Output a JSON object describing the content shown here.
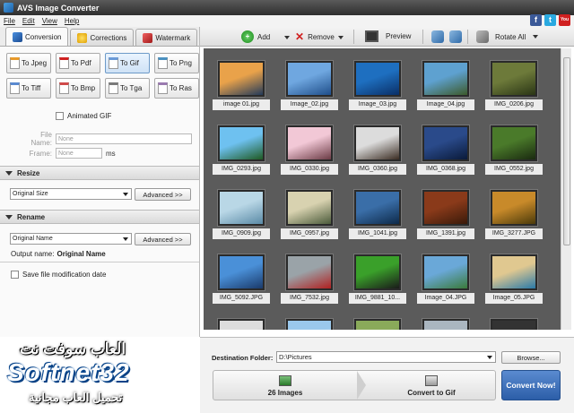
{
  "window": {
    "title": "AVS Image Converter"
  },
  "menu": [
    "File",
    "Edit",
    "View",
    "Help"
  ],
  "social": [
    {
      "icon": "facebook-icon",
      "glyph": "f",
      "color": "#3b5998"
    },
    {
      "icon": "twitter-icon",
      "glyph": "t",
      "color": "#2aa9e0"
    },
    {
      "icon": "youtube-icon",
      "glyph": "You",
      "color": "#d02020"
    }
  ],
  "tabs": [
    {
      "label": "Conversion",
      "icon": "conversion-icon",
      "active": true
    },
    {
      "label": "Corrections",
      "icon": "star-icon"
    },
    {
      "label": "Watermark",
      "icon": "watermark-icon"
    }
  ],
  "formats": [
    {
      "label": "To Jpeg"
    },
    {
      "label": "To Pdf"
    },
    {
      "label": "To Gif",
      "selected": true
    },
    {
      "label": "To Png"
    },
    {
      "label": "To Tiff"
    },
    {
      "label": "To Bmp"
    },
    {
      "label": "To Tga"
    },
    {
      "label": "To Ras"
    }
  ],
  "gif": {
    "animated_label": "Animated GIF",
    "file_name_label": "File Name:",
    "file_name_value": "None",
    "frame_label": "Frame:",
    "frame_value": "None",
    "frame_unit": "ms"
  },
  "resize": {
    "title": "Resize",
    "value": "Original Size",
    "advanced": "Advanced >>"
  },
  "rename": {
    "title": "Rename",
    "value": "Original Name",
    "advanced": "Advanced >>",
    "output_label": "Output name:",
    "output_value": "Original Name"
  },
  "save_mod_date": "Save file modification date",
  "toolbar": {
    "add": "Add",
    "remove": "Remove",
    "preview": "Preview",
    "rotate_all": "Rotate All"
  },
  "images": [
    {
      "name": "image 01.jpg",
      "c1": "#e9a24a",
      "c2": "#223a5a"
    },
    {
      "name": "Image_02.jpg",
      "c1": "#6fa7e0",
      "c2": "#1f4e8a"
    },
    {
      "name": "Image_03.jpg",
      "c1": "#1e6fc0",
      "c2": "#0a2f66"
    },
    {
      "name": "Image_04.jpg",
      "c1": "#5ea1d0",
      "c2": "#3d5a2a"
    },
    {
      "name": "IMG_0206.jpg",
      "c1": "#6d7a3a",
      "c2": "#2a3515"
    },
    {
      "name": "IMG_0293.jpg",
      "c1": "#6ec1f0",
      "c2": "#1f5a22"
    },
    {
      "name": "IMG_0330.jpg",
      "c1": "#f2c8d6",
      "c2": "#6a3a44"
    },
    {
      "name": "IMG_0360.jpg",
      "c1": "#dcdcdc",
      "c2": "#3a2c22"
    },
    {
      "name": "IMG_0368.jpg",
      "c1": "#2a4a8a",
      "c2": "#0a1a3a"
    },
    {
      "name": "IMG_0552.jpg",
      "c1": "#4a7a2a",
      "c2": "#1a2a10"
    },
    {
      "name": "IMG_0909.jpg",
      "c1": "#b9d7e6",
      "c2": "#5a8aa6"
    },
    {
      "name": "IMG_0957.jpg",
      "c1": "#d8d2b0",
      "c2": "#4a5a3a"
    },
    {
      "name": "IMG_1041.jpg",
      "c1": "#3a6ea8",
      "c2": "#0d2a4a"
    },
    {
      "name": "IMG_1391.jpg",
      "c1": "#8a3a1a",
      "c2": "#3a1a0a"
    },
    {
      "name": "IMG_3277.JPG",
      "c1": "#c88a2a",
      "c2": "#4a3a0a"
    },
    {
      "name": "IMG_5092.JPG",
      "c1": "#4a90d8",
      "c2": "#1a3a6a"
    },
    {
      "name": "IMG_7532.jpg",
      "c1": "#9aa3a8",
      "c2": "#b02020"
    },
    {
      "name": "IMG_9881_10...",
      "c1": "#3aa02a",
      "c2": "#1a1a1a"
    },
    {
      "name": "Image_04.JPG",
      "c1": "#6aa8d8",
      "c2": "#3a7a3a"
    },
    {
      "name": "Image_05.JPG",
      "c1": "#e0c890",
      "c2": "#2a7aa8"
    },
    {
      "name": "",
      "c1": "#ddd",
      "c2": "#aaa"
    },
    {
      "name": "",
      "c1": "#9ac8ec",
      "c2": "#cfe4f4"
    },
    {
      "name": "",
      "c1": "#8aaa5a",
      "c2": "#3a5a2a"
    },
    {
      "name": "",
      "c1": "#aab6c0",
      "c2": "#7a8a90"
    },
    {
      "name": "",
      "c1": "#333",
      "c2": "#111"
    }
  ],
  "bottom": {
    "dest_label": "Destination Folder:",
    "dest_value": "D:\\Pictures",
    "browse": "Browse...",
    "count": "26 Images",
    "convert_to": "Convert to Gif",
    "convert_now": "Convert Now!"
  },
  "watermark": {
    "line1": "العاب سوفت نت",
    "line2": "Softnet32",
    "line3": "تحميل العاب مجانية"
  }
}
